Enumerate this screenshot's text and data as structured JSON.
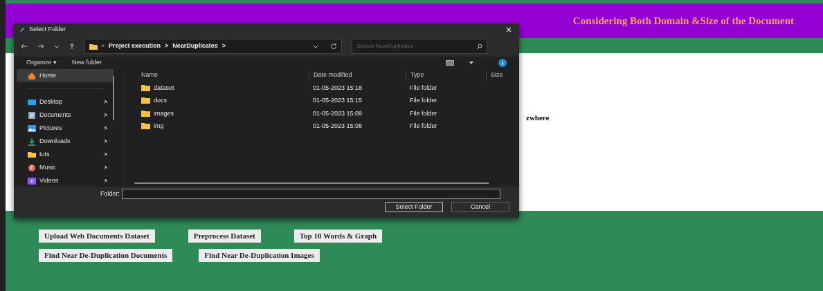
{
  "page": {
    "title": "Considering Both Domain &Size of the Document",
    "panel_text": "zwhere",
    "buttons": [
      [
        "Upload Web Documents Dataset",
        "Preprocess Dataset",
        "Top 10 Words & Graph"
      ],
      [
        "Find Near De-Duplication Documents",
        "Find Near De-Duplication Images"
      ]
    ]
  },
  "dialog": {
    "title": "Select Folder",
    "breadcrumb": [
      "«",
      "Project execution",
      ">",
      "NearDuplicates",
      ">"
    ],
    "search": {
      "placeholder": "Search NearDuplicates"
    },
    "toolbar": [
      "Organize ▾",
      "New folder"
    ],
    "sidebar": [
      {
        "label": "Home",
        "kind": "home",
        "selected": true,
        "pinned": false
      },
      {
        "label": "Desktop",
        "kind": "desktop",
        "selected": false,
        "pinned": true
      },
      {
        "label": "Documents",
        "kind": "documents",
        "selected": false,
        "pinned": true
      },
      {
        "label": "Pictures",
        "kind": "pictures",
        "selected": false,
        "pinned": true
      },
      {
        "label": "Downloads",
        "kind": "downloads",
        "selected": false,
        "pinned": true
      },
      {
        "label": "tuts",
        "kind": "folder",
        "selected": false,
        "pinned": true
      },
      {
        "label": "Music",
        "kind": "music",
        "selected": false,
        "pinned": true
      },
      {
        "label": "Videos",
        "kind": "videos",
        "selected": false,
        "pinned": true
      }
    ],
    "columns": [
      "Name",
      "Date modified",
      "Type",
      "Size"
    ],
    "rows": [
      {
        "name": "dataset",
        "date": "01-05-2023 15:18",
        "type": "File folder"
      },
      {
        "name": "docs",
        "date": "01-05-2023 15:15",
        "type": "File folder"
      },
      {
        "name": "images",
        "date": "01-05-2023 15:09",
        "type": "File folder"
      },
      {
        "name": "img",
        "date": "01-05-2023 15:08",
        "type": "File folder"
      }
    ],
    "folder_label": "Folder:",
    "actions": [
      "Select Folder",
      "Cancel"
    ]
  }
}
